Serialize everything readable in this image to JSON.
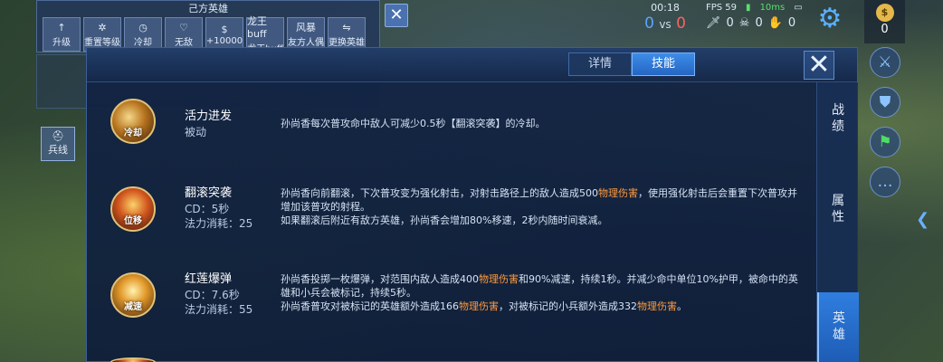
{
  "cheat": {
    "title": "己方英雄",
    "buttons": [
      {
        "icon": "↑",
        "label": "升级"
      },
      {
        "icon": "✲",
        "label": "重置等级"
      },
      {
        "icon": "◷",
        "label": "冷却"
      },
      {
        "icon": "♡",
        "label": "无敌"
      },
      {
        "icon": "$",
        "label": "+10000"
      },
      {
        "icon": "龙王buff",
        "label": "龙王buff"
      },
      {
        "icon": "风暴",
        "label": "友方人偶"
      },
      {
        "icon": "⇋",
        "label": "更换英雄"
      }
    ],
    "soldier_label": "兵线"
  },
  "hud": {
    "time": "00:18",
    "score_blue": "0",
    "score_vs": "vs",
    "score_red": "0",
    "fps": "FPS 59",
    "ping": "10ms",
    "kills": "0",
    "deaths": "0",
    "assists": "0",
    "gold": "0"
  },
  "panel": {
    "tabs": [
      {
        "label": "详情",
        "active": false
      },
      {
        "label": "技能",
        "active": true
      }
    ],
    "side_tabs": [
      {
        "label": "战绩",
        "active": false
      },
      {
        "label": "属性",
        "active": false
      },
      {
        "label": "英雄",
        "active": true
      }
    ],
    "skills": [
      {
        "name": "活力进发",
        "sub1": "被动",
        "sub2": "",
        "icon_label": "冷却",
        "desc": [
          {
            "t": "孙尚香每次普攻命中敌人可减少0.5秒【翻滚突袭】的冷却。",
            "c": ""
          }
        ]
      },
      {
        "name": "翻滚突袭",
        "sub1": "CD：5秒",
        "sub2": "法力消耗：25",
        "icon_label": "位移",
        "desc": [
          {
            "t": "孙尚香向前翻滚，下次普攻变为强化射击，对射击路径上的敌人造成500",
            "c": ""
          },
          {
            "t": "物理伤害",
            "c": "dmg"
          },
          {
            "t": "，使用强化射击后会重置下次普攻并增加该普攻的射程。",
            "c": ""
          },
          {
            "t": "\n如果翻滚后附近有敌方英雄，孙尚香会增加80%移速，2秒内随时间衰减。",
            "c": ""
          }
        ]
      },
      {
        "name": "红莲爆弹",
        "sub1": "CD：7.6秒",
        "sub2": "法力消耗：55",
        "icon_label": "减速",
        "desc": [
          {
            "t": "孙尚香投掷一枚爆弹，对范围内敌人造成400",
            "c": ""
          },
          {
            "t": "物理伤害",
            "c": "dmg"
          },
          {
            "t": "和90%减速，持续1秒。并减少命中单位10%护甲，被命中的英雄和小兵会被标记，持续5秒。",
            "c": ""
          },
          {
            "t": "\n孙尚香普攻对被标记的英雄额外造成166",
            "c": ""
          },
          {
            "t": "物理伤害",
            "c": "dmg"
          },
          {
            "t": "，对被标记的小兵额外造成332",
            "c": ""
          },
          {
            "t": "物理伤害",
            "c": "dmg"
          },
          {
            "t": "。",
            "c": ""
          }
        ]
      }
    ]
  }
}
